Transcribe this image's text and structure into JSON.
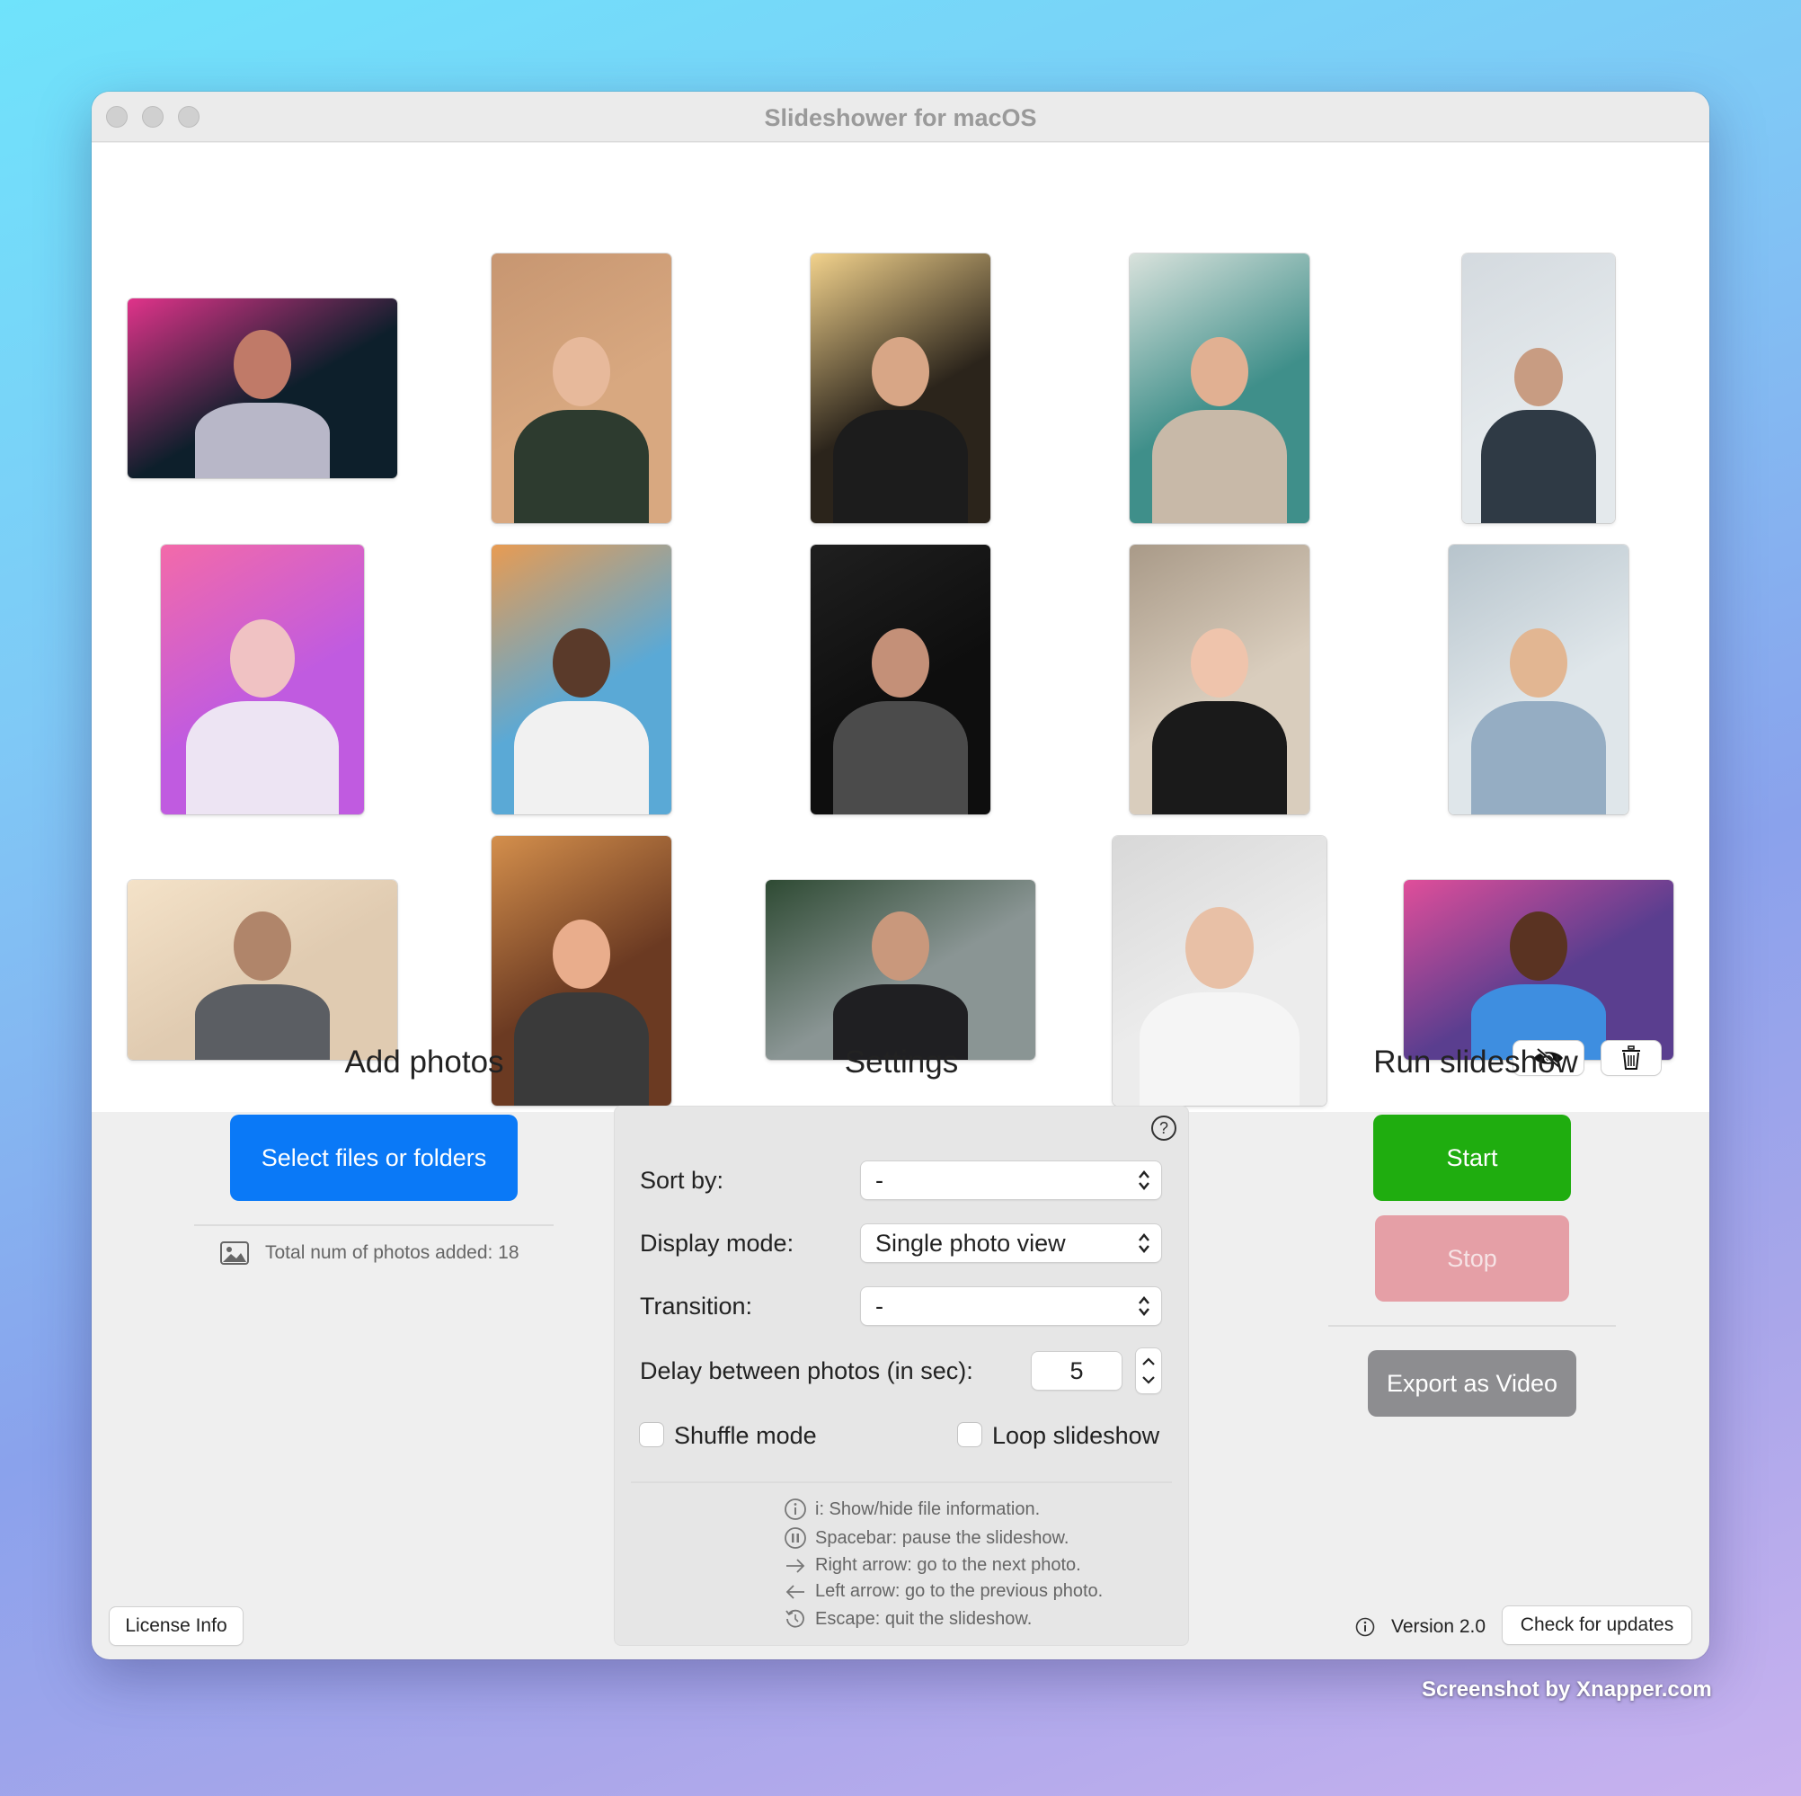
{
  "window": {
    "title": "Slideshower for macOS"
  },
  "photos": [
    {
      "name": "photo-1",
      "bg": "#0d1f2b",
      "accent": "#e0338a",
      "skin": "#c07a68",
      "shirt": "#b8b7c8"
    },
    {
      "name": "photo-2",
      "bg": "#d8a880",
      "accent": "#c79671",
      "skin": "#e7b99b",
      "shirt": "#2d3b2f"
    },
    {
      "name": "photo-3",
      "bg": "#2b241b",
      "accent": "#f2d28c",
      "skin": "#d8a686",
      "shirt": "#1c1c1c"
    },
    {
      "name": "photo-4",
      "bg": "#3f8f8a",
      "accent": "#d9e2dc",
      "skin": "#e1b092",
      "shirt": "#c8b9a8"
    },
    {
      "name": "photo-5",
      "bg": "#e4e9ec",
      "accent": "#d4dadf",
      "skin": "#c89c82",
      "shirt": "#2f3a45"
    },
    {
      "name": "photo-6",
      "bg": "#c05be0",
      "accent": "#f36aa9",
      "skin": "#f0c2c3",
      "shirt": "#ede4f3"
    },
    {
      "name": "photo-7",
      "bg": "#5aa9d6",
      "accent": "#e89b52",
      "skin": "#5a3a2a",
      "shirt": "#f1f1f1"
    },
    {
      "name": "photo-8",
      "bg": "#0e0e0e",
      "accent": "#1f1f1f",
      "skin": "#c49078",
      "shirt": "#4b4b4b"
    },
    {
      "name": "photo-9",
      "bg": "#d9cdbd",
      "accent": "#a99a88",
      "skin": "#efc4ac",
      "shirt": "#1a1a1a"
    },
    {
      "name": "photo-10",
      "bg": "#dfe6ea",
      "accent": "#b7c4cc",
      "skin": "#e2b692",
      "shirt": "#95adc3"
    },
    {
      "name": "photo-11",
      "bg": "#e0cbb1",
      "accent": "#f4e2c8",
      "skin": "#b0856a",
      "shirt": "#5b5e63"
    },
    {
      "name": "photo-12",
      "bg": "#6b3a22",
      "accent": "#d48f4c",
      "skin": "#e9ad8c",
      "shirt": "#3a3a3a"
    },
    {
      "name": "photo-13",
      "bg": "#8a9594",
      "accent": "#2e4a33",
      "skin": "#c9987c",
      "shirt": "#1f1f22"
    },
    {
      "name": "photo-14",
      "bg": "#ececec",
      "accent": "#d8d8d8",
      "skin": "#e8c0a6",
      "shirt": "#f5f5f5"
    },
    {
      "name": "photo-15",
      "bg": "#5a3e8f",
      "accent": "#e04e9a",
      "skin": "#5a3322",
      "shirt": "#3e8ee0"
    }
  ],
  "add_photos": {
    "title": "Add photos",
    "select_button": "Select files or folders",
    "total_label": "Total num of photos added: 18"
  },
  "settings": {
    "title": "Settings",
    "sort_label": "Sort by:",
    "sort_value": "-",
    "display_label": "Display mode:",
    "display_value": "Single photo view",
    "transition_label": "Transition:",
    "transition_value": "-",
    "delay_label": "Delay between photos (in sec):",
    "delay_value": "5",
    "shuffle_label": "Shuffle mode",
    "loop_label": "Loop slideshow",
    "hints": [
      "i: Show/hide file information.",
      "Spacebar: pause the slideshow.",
      "Right arrow: go to the next photo.",
      "Left arrow: go to the previous photo.",
      "Escape: quit the slideshow."
    ]
  },
  "run": {
    "title": "Run slideshow",
    "start": "Start",
    "stop": "Stop",
    "export": "Export as Video"
  },
  "footer": {
    "license": "License Info",
    "version": "Version 2.0",
    "updates": "Check for updates"
  },
  "watermark": "Screenshot by Xnapper.com",
  "colors": {
    "blue_button": "#0a79f7",
    "start_button": "#1fad0f",
    "stop_button": "#e59fa6",
    "export_button": "#8d8d90"
  }
}
